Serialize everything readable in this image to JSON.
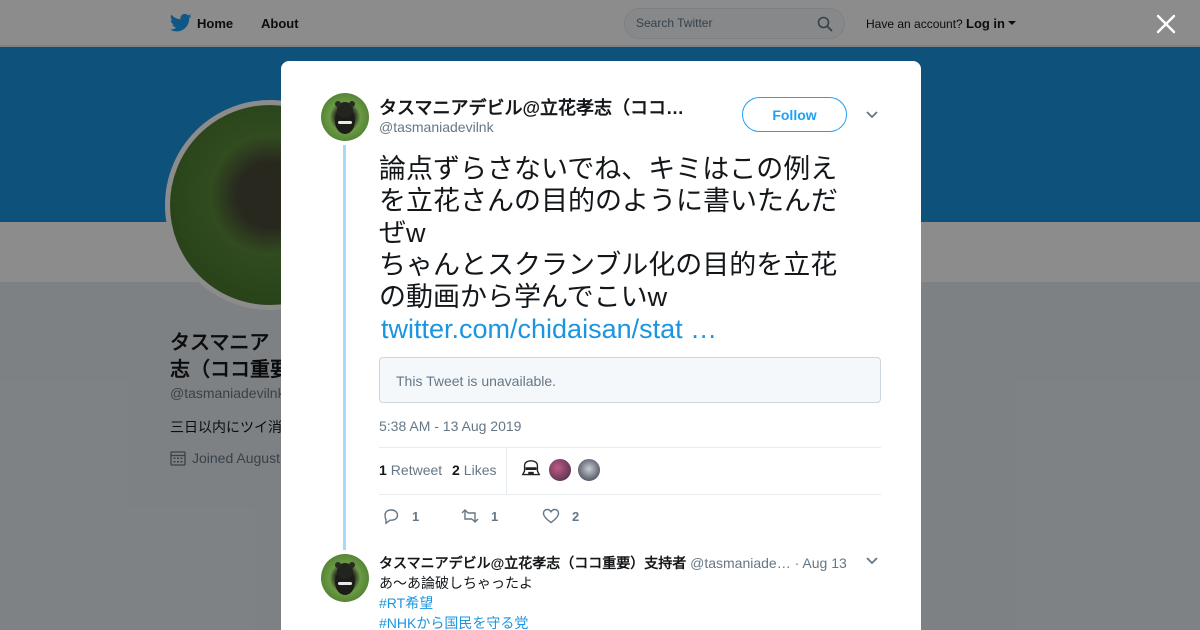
{
  "nav": {
    "home_label": "Home",
    "about_label": "About",
    "search_placeholder": "Search Twitter",
    "have_account": "Have an account?",
    "login_label": "Log in"
  },
  "profile": {
    "name": "タスマニア\n志（ココ重要",
    "handle": "@tasmaniadevilnk",
    "bio": "三日以内にツイ消",
    "joined": "Joined August"
  },
  "tweet": {
    "author_name": "タスマニアデビル@立花孝志（ココ重要）支持者",
    "author_handle": "@tasmaniadevilnk",
    "follow_label": "Follow",
    "text": "論点ずらさないでね、キミはこの例え\nを立花さんの目的のように書いたんだ\nぜw\nちゃんとスクランブル化の目的を立花\nの動画から学んでこいw",
    "link": "twitter.com/chidaisan/stat …",
    "quoted_unavailable": "This Tweet is unavailable.",
    "timestamp": "5:38 AM - 13 Aug 2019",
    "retweet_count": "1",
    "retweet_label": "Retweet",
    "like_count": "2",
    "like_label": "Likes",
    "actions": {
      "reply_count": "1",
      "retweet_count": "1",
      "like_count": "2"
    }
  },
  "reply": {
    "author_name": "タスマニアデビル@立花孝志（ココ重要）支持者",
    "author_handle": "@tasmaniade…",
    "time": "· Aug 13",
    "text": "あ〜あ論破しちゃったよ",
    "hashtag1": "#RT希望",
    "hashtag2": "#NHKから国民を守る党"
  },
  "colors": {
    "accent": "#1da1f2",
    "link": "#1b95e0",
    "banner": "#1b95e0",
    "thread_line": "#a6daf7",
    "muted_text": "#657786"
  },
  "icons": [
    "twitter-bird-icon",
    "search-icon",
    "close-icon",
    "chevron-down-icon",
    "reply-icon",
    "retweet-icon",
    "heart-icon",
    "calendar-icon"
  ]
}
